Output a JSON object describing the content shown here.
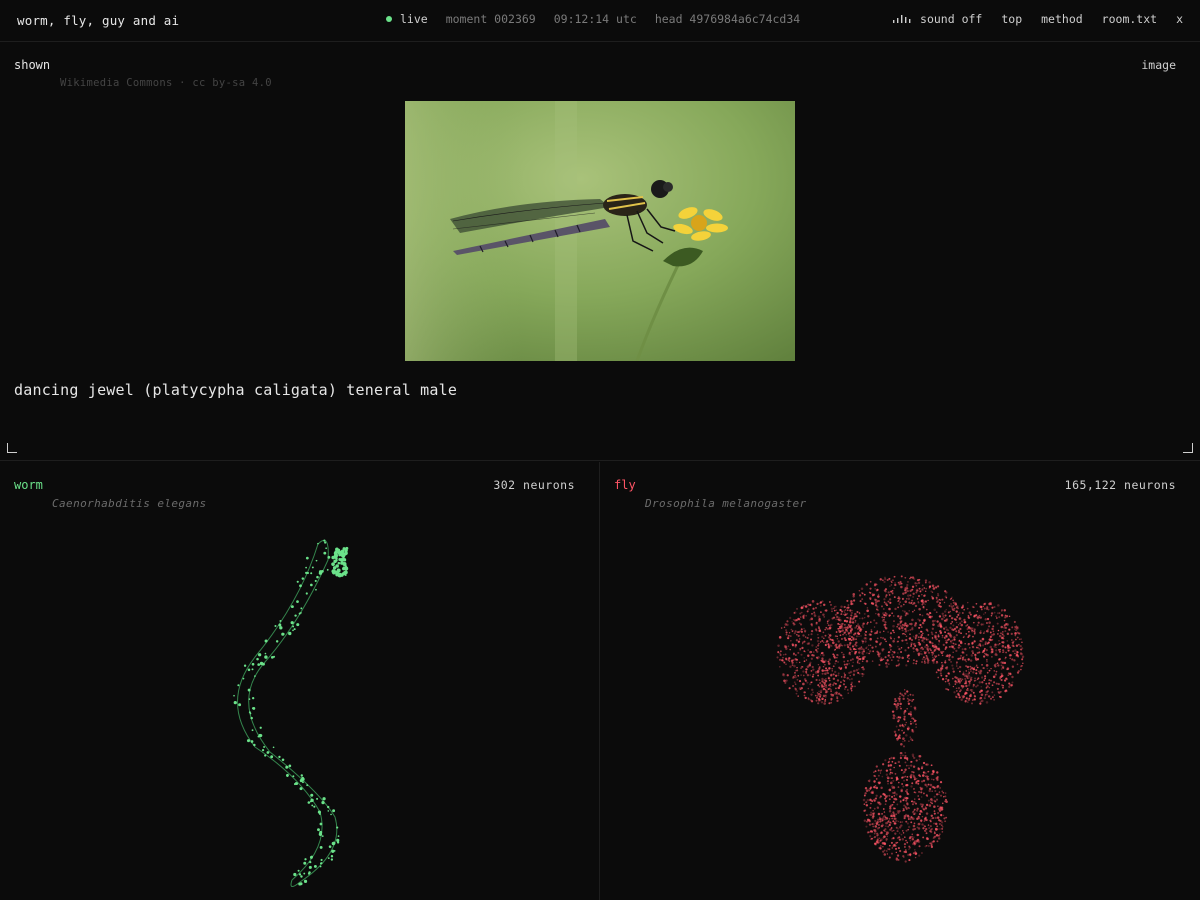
{
  "header": {
    "title": "worm, fly, guy and ai",
    "live_label": "live",
    "moment": "moment 002369",
    "clock": "09:12:14 utc",
    "head": "head 4976984a6c74cd34",
    "nav": {
      "sound": "sound off",
      "top": "top",
      "method": "method",
      "room": "room.txt",
      "close": "x"
    }
  },
  "shown": {
    "label": "shown",
    "kind": "image",
    "credit": "Wikimedia Commons · cc by-sa 4.0",
    "caption": "dancing jewel (platycypha caligata) teneral male"
  },
  "worm": {
    "name": "worm",
    "species": "Caenorhabditis elegans",
    "neurons": "302 neurons"
  },
  "fly": {
    "name": "fly",
    "species": "Drosophila melanogaster",
    "neurons": "165,122 neurons"
  },
  "colors": {
    "worm": "#6be28a",
    "fly": "#ff5566",
    "live": "#6be28a"
  }
}
